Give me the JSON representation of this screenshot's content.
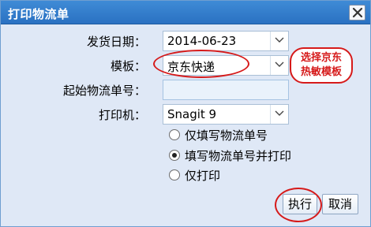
{
  "window": {
    "title": "打印物流单",
    "close_icon": "close-icon"
  },
  "form": {
    "ship_date_label": "发货日期：",
    "ship_date_value": "2014-06-23",
    "template_label": "模板：",
    "template_value": "京东快递",
    "start_tracking_label": "起始物流单号：",
    "start_tracking_value": "",
    "printer_label": "打印机：",
    "printer_value": "Snagit 9"
  },
  "options": [
    {
      "label": "仅填写物流单号",
      "checked": false
    },
    {
      "label": "填写物流单号并打印",
      "checked": true
    },
    {
      "label": "仅打印",
      "checked": false
    }
  ],
  "buttons": {
    "execute": "执行",
    "cancel": "取消"
  },
  "annotation": {
    "line1": "选择京东",
    "line2": "热敏模板",
    "color": "#d61a1a"
  }
}
